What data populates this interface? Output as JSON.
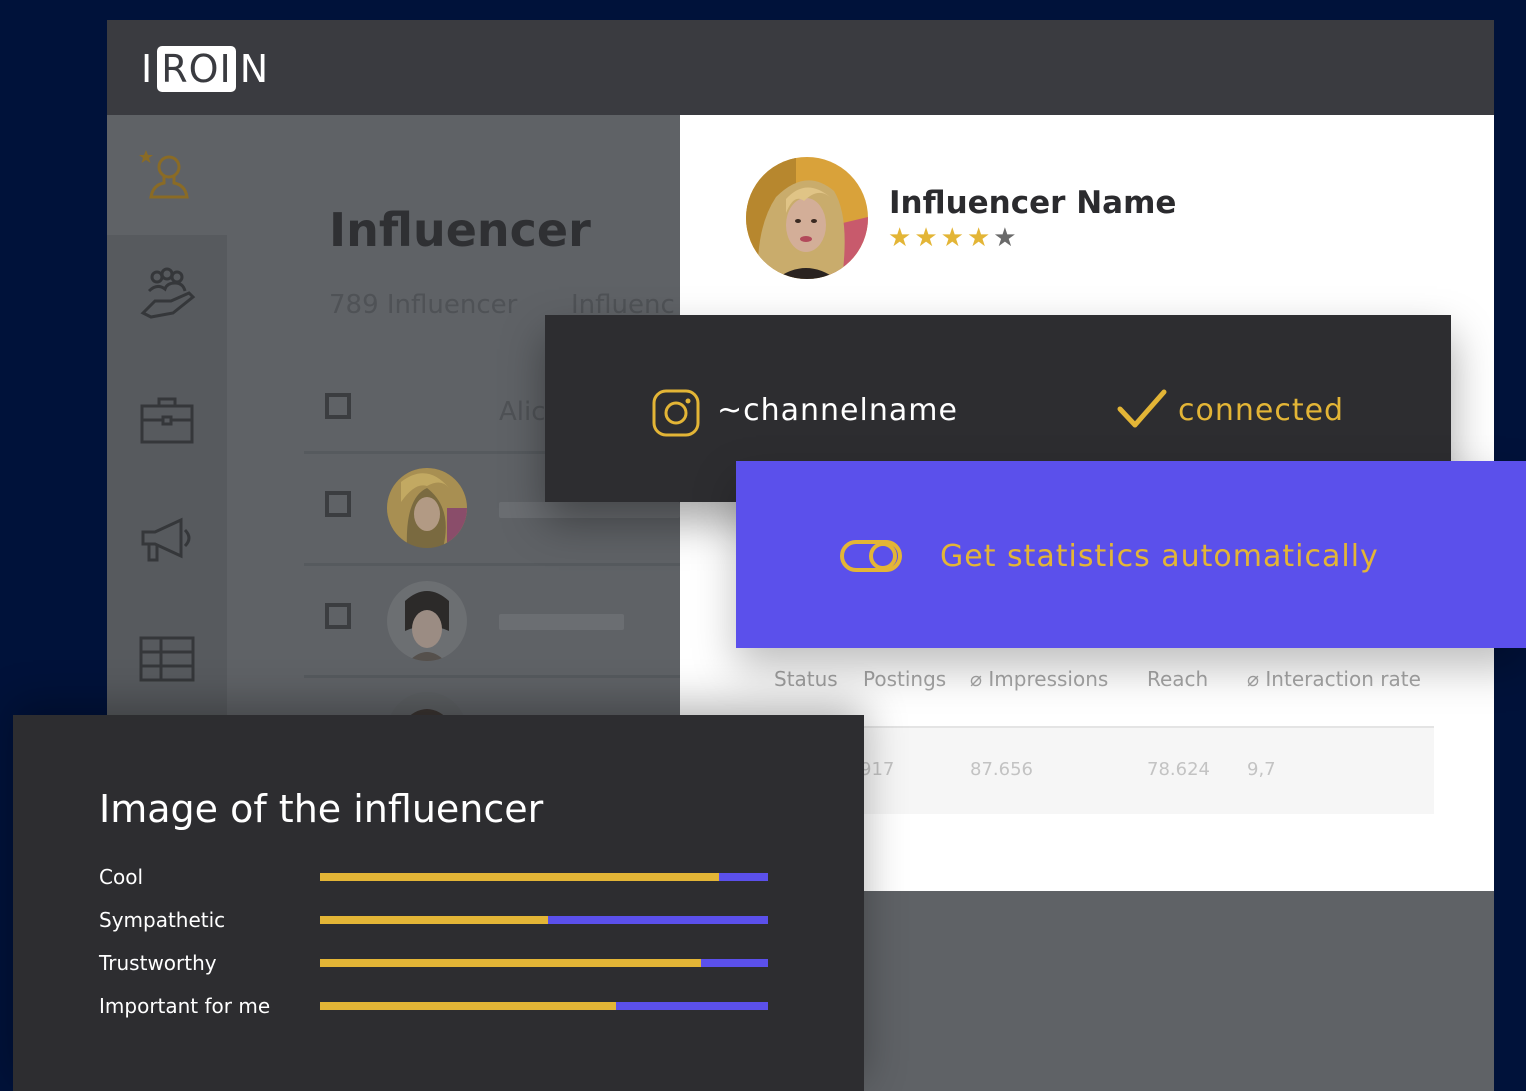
{
  "colors": {
    "background": "#00123a",
    "accent_yellow": "#e3b536",
    "accent_purple": "#5b50eb",
    "card_dark": "#2d2d30",
    "topbar": "#3a3b40"
  },
  "logo": {
    "left": "I",
    "boxed": "ROI",
    "right": "N"
  },
  "sidebar": {
    "items": [
      {
        "icon": "influencer-star-icon",
        "active": true
      },
      {
        "icon": "community-hand-icon",
        "active": false
      },
      {
        "icon": "briefcase-icon",
        "active": false
      },
      {
        "icon": "megaphone-icon",
        "active": false
      },
      {
        "icon": "table-icon",
        "active": false
      }
    ]
  },
  "list": {
    "title": "Influencer",
    "count": "789 Influencer",
    "tab": "Influenc",
    "column_name": "Alic"
  },
  "profile": {
    "name": "Influencer Name",
    "rating": 4,
    "max_rating": 5,
    "avatar_icon": "influencer-avatar"
  },
  "channel": {
    "icon": "instagram-icon",
    "name": "~channelname",
    "status_icon": "check-icon",
    "status": "connected"
  },
  "auto_stats": {
    "icon": "toggle-icon",
    "label": "Get statistics automatically"
  },
  "stats_table": {
    "headers": [
      "Status",
      "Postings",
      "⌀ Impressions",
      "Reach",
      "⌀ Interaction rate"
    ],
    "row": [
      "",
      "917",
      "87.656",
      "78.624",
      "9,7"
    ]
  },
  "image_rating": {
    "title": "Image of the influencer",
    "attributes": [
      {
        "label": "Cool",
        "value": 0.89
      },
      {
        "label": "Sympathetic",
        "value": 0.51
      },
      {
        "label": "Trustworthy",
        "value": 0.85
      },
      {
        "label": "Important for me",
        "value": 0.66
      }
    ]
  }
}
